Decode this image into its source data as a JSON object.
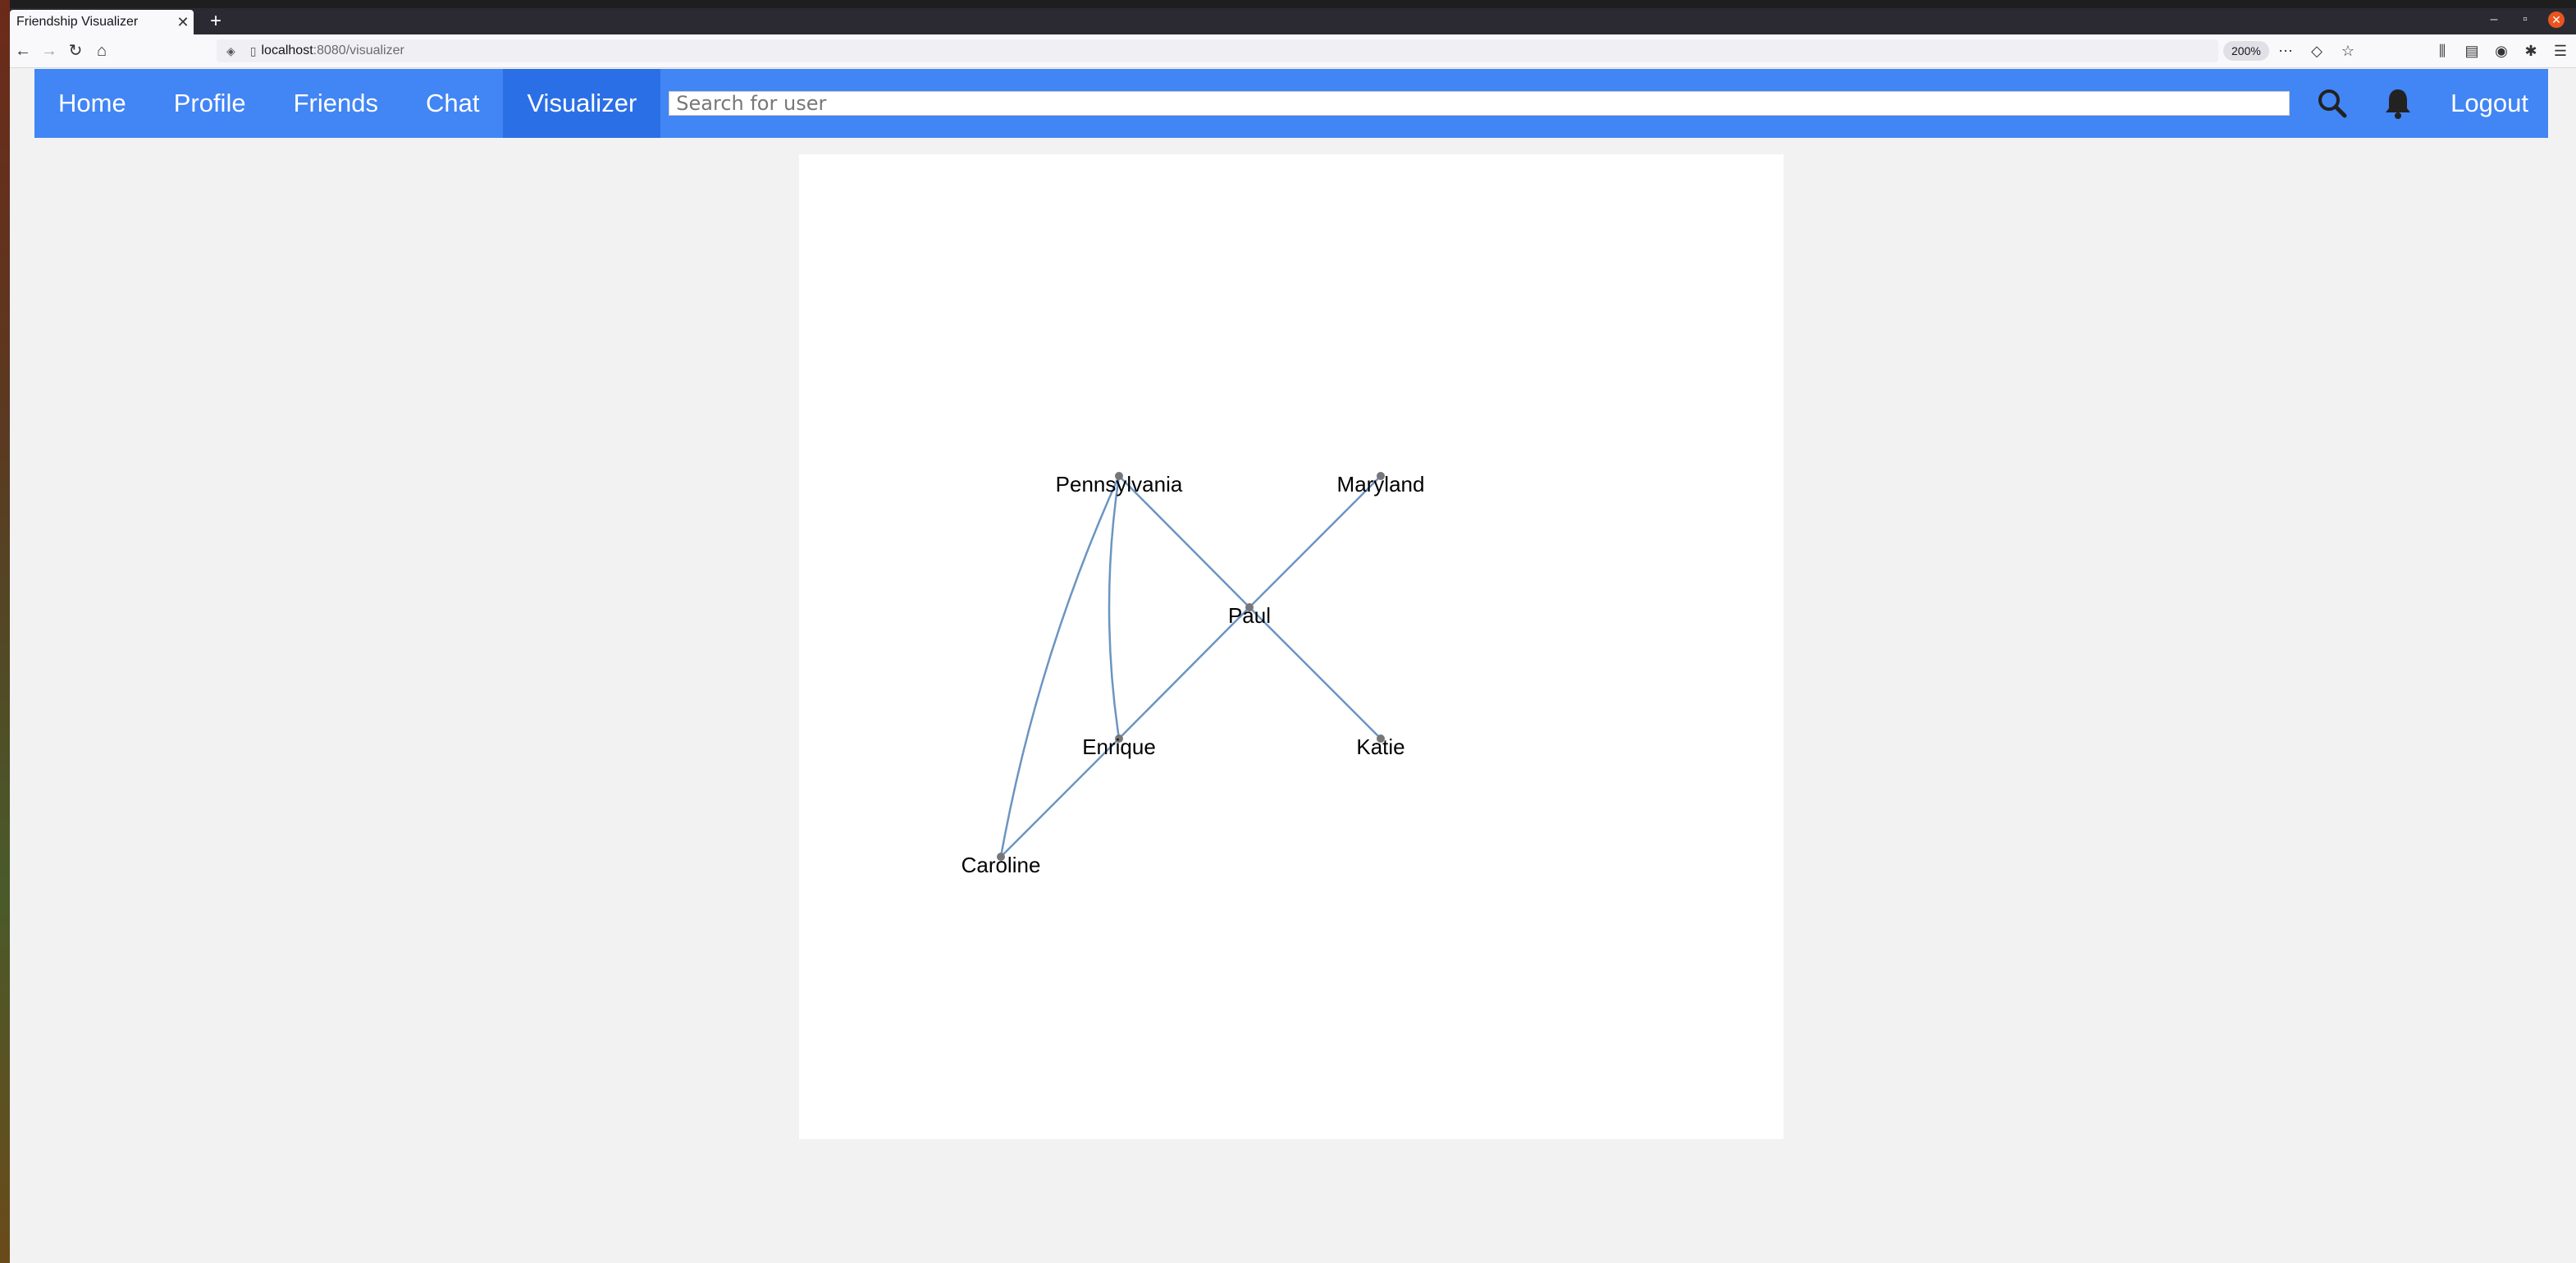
{
  "browser": {
    "tab_title": "Friendship Visualizer",
    "tab_close": "✕",
    "new_tab": "+",
    "url_host": "localhost",
    "url_path": ":8080/visualizer",
    "zoom": "200%"
  },
  "navbar": {
    "items": [
      {
        "label": "Home",
        "active": false
      },
      {
        "label": "Profile",
        "active": false
      },
      {
        "label": "Friends",
        "active": false
      },
      {
        "label": "Chat",
        "active": false
      },
      {
        "label": "Visualizer",
        "active": true
      }
    ],
    "search_placeholder": "Search for user",
    "logout_label": "Logout",
    "search_icon": "search-icon",
    "notification_icon": "bell-icon",
    "accent_color": "#4285f4",
    "active_color": "#2b6fe6"
  },
  "graph": {
    "nodes": [
      {
        "id": "Pennsylvania",
        "label": "Pennsylvania"
      },
      {
        "id": "Maryland",
        "label": "Maryland"
      },
      {
        "id": "Paul",
        "label": "Paul"
      },
      {
        "id": "Enrique",
        "label": "Enrique"
      },
      {
        "id": "Katie",
        "label": "Katie"
      },
      {
        "id": "Caroline",
        "label": "Caroline"
      }
    ],
    "edges": [
      {
        "source": "Pennsylvania",
        "target": "Paul"
      },
      {
        "source": "Maryland",
        "target": "Paul"
      },
      {
        "source": "Paul",
        "target": "Katie"
      },
      {
        "source": "Paul",
        "target": "Enrique"
      },
      {
        "source": "Enrique",
        "target": "Caroline"
      },
      {
        "source": "Pennsylvania",
        "target": "Enrique"
      },
      {
        "source": "Pennsylvania",
        "target": "Caroline"
      }
    ],
    "edge_color": "#6b95c2",
    "node_color": "#777777"
  }
}
